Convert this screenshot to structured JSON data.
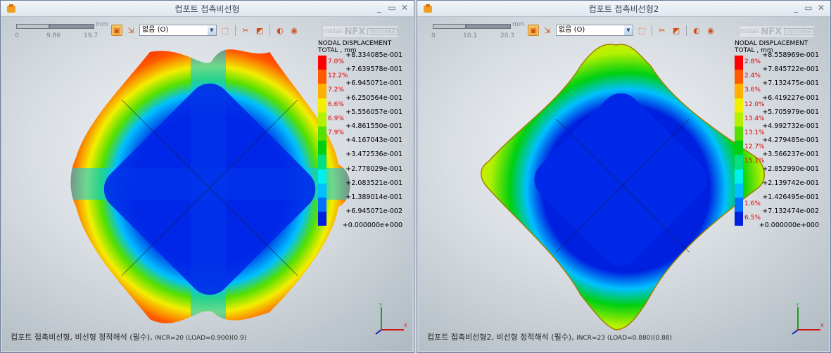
{
  "windows": [
    {
      "title": "컵포트 접촉비선형",
      "scale": {
        "unit": "mm",
        "ticks": [
          "0",
          "9.86",
          "19.7"
        ]
      },
      "result_combo": "없음 (O)",
      "logo": {
        "small": "midas",
        "big": "NFX",
        "tag": "DESIGNER"
      },
      "legend": {
        "title1": "NODAL DISPLACEMENT",
        "title2": "TOTAL , mm",
        "values": [
          "+8.334085e-001",
          "+7.639578e-001",
          "+6.945071e-001",
          "+6.250564e-001",
          "+5.556057e-001",
          "+4.861550e-001",
          "+4.167043e-001",
          "+3.472536e-001",
          "+2.778029e-001",
          "+2.083521e-001",
          "+1.389014e-001",
          "+6.945071e-002",
          "+0.000000e+000"
        ],
        "percents": [
          "7.0%",
          "12.2%",
          "7.2%",
          "6.6%",
          "6.9%",
          "7.9%",
          "",
          "",
          "",
          "",
          "",
          "",
          ""
        ],
        "colors": [
          "#ff0000",
          "#ff5a00",
          "#ffb000",
          "#f2ee00",
          "#b4f000",
          "#55e000",
          "#00d010",
          "#00e080",
          "#00f0f0",
          "#00c0ff",
          "#0070ff",
          "#0020e0"
        ]
      },
      "caption": "컵포트 접촉비선형, 비선형 정적해석 (필수),",
      "caption_small": "INCR=20 (LOAD=0.900)(0.9)",
      "controls": {
        "minimize": "_",
        "maximize": "▭",
        "close": "✕"
      }
    },
    {
      "title": "컵포트 접촉비선형2",
      "scale": {
        "unit": "mm",
        "ticks": [
          "0",
          "10.1",
          "20.3"
        ]
      },
      "result_combo": "없음 (O)",
      "logo": {
        "small": "midas",
        "big": "NFX",
        "tag": "DESIGNER"
      },
      "legend": {
        "title1": "NODAL DISPLACEMENT",
        "title2": "TOTAL , mm",
        "values": [
          "+8.558969e-001",
          "+7.845722e-001",
          "+7.132475e-001",
          "+6.419227e-001",
          "+5.705979e-001",
          "+4.992732e-001",
          "+4.279485e-001",
          "+3.566237e-001",
          "+2.852990e-001",
          "+2.139742e-001",
          "+1.426495e-001",
          "+7.132474e-002",
          "+0.000000e+000"
        ],
        "percents": [
          "2.8%",
          "2.4%",
          "3.6%",
          "12.0%",
          "13.4%",
          "13.1%",
          "12.7%",
          "15.1%",
          "",
          "",
          "1.6%",
          "6.5%"
        ],
        "colors": [
          "#ff0000",
          "#ff5a00",
          "#ffb000",
          "#f2ee00",
          "#b4f000",
          "#55e000",
          "#00d010",
          "#00e080",
          "#00f0f0",
          "#00c0ff",
          "#0070ff",
          "#0020e0"
        ]
      },
      "caption": "컵포트 접촉비선형2, 비선형 정적해석 (필수),",
      "caption_small": "INCR=23 (LOAD=0.880)(0.88)",
      "controls": {
        "minimize": "_",
        "maximize": "▭",
        "close": "✕"
      }
    }
  ]
}
